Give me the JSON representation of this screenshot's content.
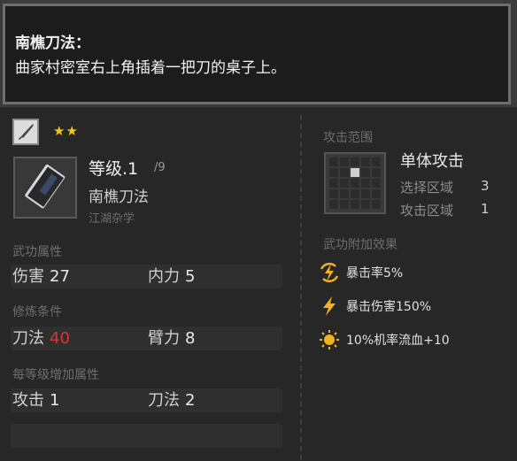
{
  "tooltip": {
    "title": "南樵刀法：",
    "description": "曲家村密室右上角插着一把刀的桌子上。"
  },
  "skill": {
    "stars": "★★",
    "level_label": "等级.1",
    "level_max": "/9",
    "name": "南樵刀法",
    "category": "江湖杂学"
  },
  "sections": {
    "martial_attr": "武功属性",
    "cultivation": "修炼条件",
    "per_level": "每等级增加属性"
  },
  "martial_attr": {
    "damage_label": "伤害",
    "damage_value": "27",
    "inner_label": "内力",
    "inner_value": "5"
  },
  "cultivation": {
    "blade_label": "刀法",
    "blade_value": "40",
    "arm_label": "臂力",
    "arm_value": "8"
  },
  "per_level": {
    "attack_label": "攻击",
    "attack_value": "1",
    "blade_label": "刀法",
    "blade_value": "2"
  },
  "attack_range": {
    "section": "攻击范围",
    "type": "单体攻击",
    "select_label": "选择区域",
    "select_value": "3",
    "attack_label": "攻击区域",
    "attack_value": "1"
  },
  "effects": {
    "section": "武功附加效果",
    "items": [
      "暴击率5%",
      "暴击伤害150%",
      "10%机率流血+10"
    ]
  },
  "colors": {
    "star": "#f3c420",
    "requirement_unmet": "#e13131",
    "effect_icon": "#f0b21e"
  }
}
